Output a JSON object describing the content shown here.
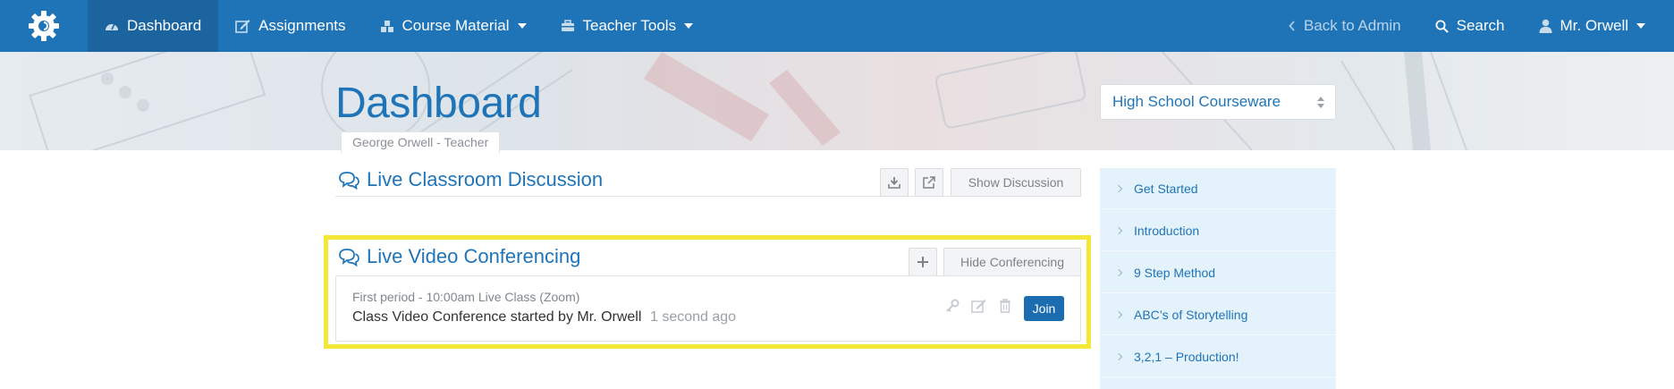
{
  "nav": {
    "dashboard": "Dashboard",
    "assignments": "Assignments",
    "course_material": "Course Material",
    "teacher_tools": "Teacher Tools",
    "back_to_admin": "Back to Admin",
    "search": "Search",
    "user": "Mr. Orwell"
  },
  "header": {
    "title": "Dashboard",
    "subtitle": "George Orwell - Teacher",
    "course_select": "High School Courseware"
  },
  "discussion": {
    "title": "Live Classroom Discussion",
    "show_button": "Show Discussion"
  },
  "conferencing": {
    "title": "Live Video Conferencing",
    "hide_button": "Hide Conferencing",
    "meeting": {
      "meta": "First period - 10:00am Live Class (Zoom)",
      "text": "Class Video Conference started by Mr. Orwell",
      "time": "1 second ago",
      "join": "Join"
    }
  },
  "sidebar": {
    "items": [
      {
        "label": "Get Started"
      },
      {
        "label": "Introduction"
      },
      {
        "label": "9 Step Method"
      },
      {
        "label": "ABC’s of Storytelling"
      },
      {
        "label": "3,2,1 – Production!"
      }
    ]
  },
  "colors": {
    "navbar": "#1f74b8",
    "accent": "#1f74b8",
    "highlight_border": "#f3e737",
    "sidebar_bg": "#e4f2fb"
  }
}
